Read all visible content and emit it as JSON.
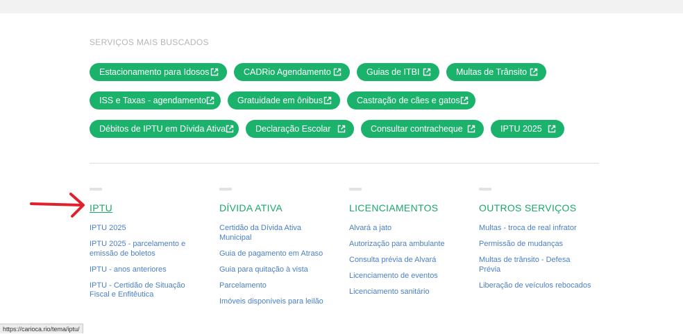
{
  "services": {
    "title": "SERVIÇOS MAIS BUSCADOS",
    "rows": [
      [
        "Estacionamento para Idosos",
        "CADRio Agendamento",
        "Guias de ITBI",
        "Multas de Trânsito"
      ],
      [
        "ISS e Taxas - agendamento",
        "Gratuidade em ônibus",
        "Castração de cães e gatos"
      ],
      [
        "Débitos de IPTU em Dívida Ativa",
        "Declaração Escolar",
        "Consultar contracheque",
        "IPTU 2025"
      ]
    ],
    "chip_icon": "external-link-icon"
  },
  "columns": [
    {
      "heading": "IPTU",
      "links": [
        "IPTU 2025",
        "IPTU 2025 - parcelamento e emissão de boletos",
        "IPTU - anos anteriores",
        "IPTU - Certidão de Situação Fiscal e Enfitêutica"
      ]
    },
    {
      "heading": "DÍVIDA ATIVA",
      "links": [
        "Certidão da Dívida Ativa Municipal",
        "Guia de pagamento em Atraso",
        "Guia para quitação à vista",
        "Parcelamento",
        "Imóveis disponíveis para leilão"
      ]
    },
    {
      "heading": "LICENCIAMENTOS",
      "links": [
        "Alvará a jato",
        "Autorização para ambulante",
        "Consulta prévia de Alvará",
        "Licenciamento de eventos",
        "Licenciamento sanitário"
      ]
    },
    {
      "heading": "OUTROS SERVIÇOS",
      "links": [
        "Multas - troca de real infrator",
        "Permissão de mudanças",
        "Multas de trânsito - Defesa Prévia",
        "Liberação de veículos rebocados"
      ]
    }
  ],
  "status_url": "https://carioca.rio/tema/iptu/",
  "colors": {
    "chip_bg": "#1bb36b",
    "heading": "#1aa86a",
    "link": "#4a7fc8",
    "annotation_arrow": "#e0202c"
  }
}
